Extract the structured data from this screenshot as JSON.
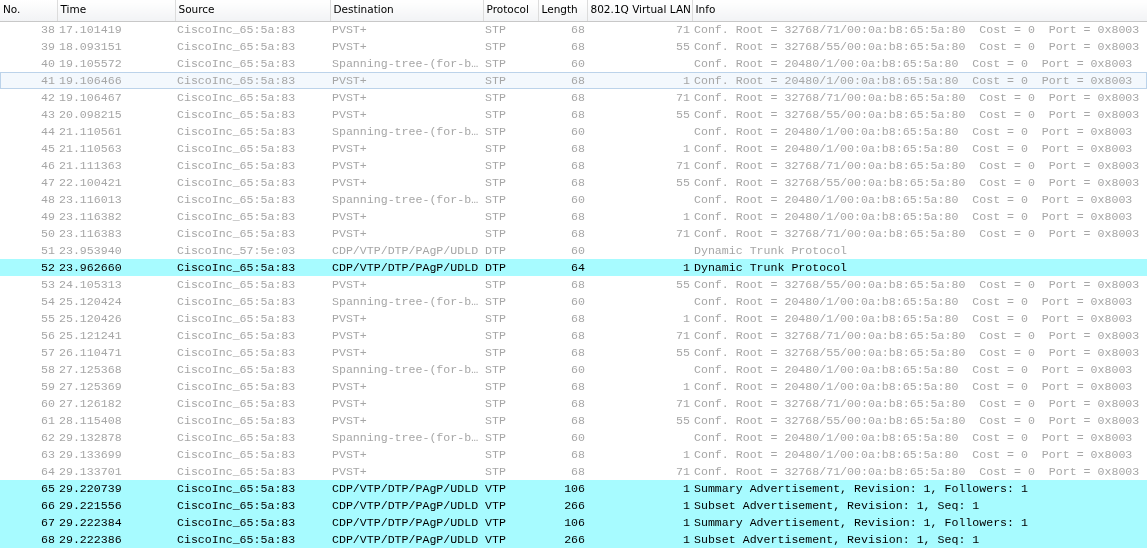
{
  "packet_list": {
    "columns": [
      "No.",
      "Time",
      "Source",
      "Destination",
      "Protocol",
      "Length",
      "802.1Q Virtual LAN",
      "Info"
    ],
    "rows": [
      {
        "no": "38",
        "time": "17.101419",
        "source": "CiscoInc_65:5a:83",
        "destination": "PVST+",
        "protocol": "STP",
        "length": "68",
        "vlan": "71",
        "info": "Conf. Root = 32768/71/00:0a:b8:65:5a:80  Cost = 0  Port = 0x8003",
        "highlighted": false,
        "selected": false
      },
      {
        "no": "39",
        "time": "18.093151",
        "source": "CiscoInc_65:5a:83",
        "destination": "PVST+",
        "protocol": "STP",
        "length": "68",
        "vlan": "55",
        "info": "Conf. Root = 32768/55/00:0a:b8:65:5a:80  Cost = 0  Port = 0x8003",
        "highlighted": false,
        "selected": false
      },
      {
        "no": "40",
        "time": "19.105572",
        "source": "CiscoInc_65:5a:83",
        "destination": "Spanning-tree-(for-b…",
        "protocol": "STP",
        "length": "60",
        "info": "Conf. Root = 20480/1/00:0a:b8:65:5a:80  Cost = 0  Port = 0x8003",
        "highlighted": false,
        "selected": false
      },
      {
        "no": "41",
        "time": "19.106466",
        "source": "CiscoInc_65:5a:83",
        "destination": "PVST+",
        "protocol": "STP",
        "length": "68",
        "vlan": "1",
        "info": "Conf. Root = 20480/1/00:0a:b8:65:5a:80  Cost = 0  Port = 0x8003",
        "highlighted": false,
        "selected": true
      },
      {
        "no": "42",
        "time": "19.106467",
        "source": "CiscoInc_65:5a:83",
        "destination": "PVST+",
        "protocol": "STP",
        "length": "68",
        "vlan": "71",
        "info": "Conf. Root = 32768/71/00:0a:b8:65:5a:80  Cost = 0  Port = 0x8003",
        "highlighted": false,
        "selected": false
      },
      {
        "no": "43",
        "time": "20.098215",
        "source": "CiscoInc_65:5a:83",
        "destination": "PVST+",
        "protocol": "STP",
        "length": "68",
        "vlan": "55",
        "info": "Conf. Root = 32768/55/00:0a:b8:65:5a:80  Cost = 0  Port = 0x8003",
        "highlighted": false,
        "selected": false
      },
      {
        "no": "44",
        "time": "21.110561",
        "source": "CiscoInc_65:5a:83",
        "destination": "Spanning-tree-(for-b…",
        "protocol": "STP",
        "length": "60",
        "info": "Conf. Root = 20480/1/00:0a:b8:65:5a:80  Cost = 0  Port = 0x8003",
        "highlighted": false,
        "selected": false
      },
      {
        "no": "45",
        "time": "21.110563",
        "source": "CiscoInc_65:5a:83",
        "destination": "PVST+",
        "protocol": "STP",
        "length": "68",
        "vlan": "1",
        "info": "Conf. Root = 20480/1/00:0a:b8:65:5a:80  Cost = 0  Port = 0x8003",
        "highlighted": false,
        "selected": false
      },
      {
        "no": "46",
        "time": "21.111363",
        "source": "CiscoInc_65:5a:83",
        "destination": "PVST+",
        "protocol": "STP",
        "length": "68",
        "vlan": "71",
        "info": "Conf. Root = 32768/71/00:0a:b8:65:5a:80  Cost = 0  Port = 0x8003",
        "highlighted": false,
        "selected": false
      },
      {
        "no": "47",
        "time": "22.100421",
        "source": "CiscoInc_65:5a:83",
        "destination": "PVST+",
        "protocol": "STP",
        "length": "68",
        "vlan": "55",
        "info": "Conf. Root = 32768/55/00:0a:b8:65:5a:80  Cost = 0  Port = 0x8003",
        "highlighted": false,
        "selected": false
      },
      {
        "no": "48",
        "time": "23.116013",
        "source": "CiscoInc_65:5a:83",
        "destination": "Spanning-tree-(for-b…",
        "protocol": "STP",
        "length": "60",
        "info": "Conf. Root = 20480/1/00:0a:b8:65:5a:80  Cost = 0  Port = 0x8003",
        "highlighted": false,
        "selected": false
      },
      {
        "no": "49",
        "time": "23.116382",
        "source": "CiscoInc_65:5a:83",
        "destination": "PVST+",
        "protocol": "STP",
        "length": "68",
        "vlan": "1",
        "info": "Conf. Root = 20480/1/00:0a:b8:65:5a:80  Cost = 0  Port = 0x8003",
        "highlighted": false,
        "selected": false
      },
      {
        "no": "50",
        "time": "23.116383",
        "source": "CiscoInc_65:5a:83",
        "destination": "PVST+",
        "protocol": "STP",
        "length": "68",
        "vlan": "71",
        "info": "Conf. Root = 32768/71/00:0a:b8:65:5a:80  Cost = 0  Port = 0x8003",
        "highlighted": false,
        "selected": false
      },
      {
        "no": "51",
        "time": "23.953940",
        "source": "CiscoInc_57:5e:03",
        "destination": "CDP/VTP/DTP/PAgP/UDLD",
        "protocol": "DTP",
        "length": "60",
        "info": "Dynamic Trunk Protocol",
        "highlighted": false,
        "selected": false
      },
      {
        "no": "52",
        "time": "23.962660",
        "source": "CiscoInc_65:5a:83",
        "destination": "CDP/VTP/DTP/PAgP/UDLD",
        "protocol": "DTP",
        "length": "64",
        "vlan": "1",
        "info": "Dynamic Trunk Protocol",
        "highlighted": true,
        "selected": false
      },
      {
        "no": "53",
        "time": "24.105313",
        "source": "CiscoInc_65:5a:83",
        "destination": "PVST+",
        "protocol": "STP",
        "length": "68",
        "vlan": "55",
        "info": "Conf. Root = 32768/55/00:0a:b8:65:5a:80  Cost = 0  Port = 0x8003",
        "highlighted": false,
        "selected": false
      },
      {
        "no": "54",
        "time": "25.120424",
        "source": "CiscoInc_65:5a:83",
        "destination": "Spanning-tree-(for-b…",
        "protocol": "STP",
        "length": "60",
        "info": "Conf. Root = 20480/1/00:0a:b8:65:5a:80  Cost = 0  Port = 0x8003",
        "highlighted": false,
        "selected": false
      },
      {
        "no": "55",
        "time": "25.120426",
        "source": "CiscoInc_65:5a:83",
        "destination": "PVST+",
        "protocol": "STP",
        "length": "68",
        "vlan": "1",
        "info": "Conf. Root = 20480/1/00:0a:b8:65:5a:80  Cost = 0  Port = 0x8003",
        "highlighted": false,
        "selected": false
      },
      {
        "no": "56",
        "time": "25.121241",
        "source": "CiscoInc_65:5a:83",
        "destination": "PVST+",
        "protocol": "STP",
        "length": "68",
        "vlan": "71",
        "info": "Conf. Root = 32768/71/00:0a:b8:65:5a:80  Cost = 0  Port = 0x8003",
        "highlighted": false,
        "selected": false
      },
      {
        "no": "57",
        "time": "26.110471",
        "source": "CiscoInc_65:5a:83",
        "destination": "PVST+",
        "protocol": "STP",
        "length": "68",
        "vlan": "55",
        "info": "Conf. Root = 32768/55/00:0a:b8:65:5a:80  Cost = 0  Port = 0x8003",
        "highlighted": false,
        "selected": false
      },
      {
        "no": "58",
        "time": "27.125368",
        "source": "CiscoInc_65:5a:83",
        "destination": "Spanning-tree-(for-b…",
        "protocol": "STP",
        "length": "60",
        "info": "Conf. Root = 20480/1/00:0a:b8:65:5a:80  Cost = 0  Port = 0x8003",
        "highlighted": false,
        "selected": false
      },
      {
        "no": "59",
        "time": "27.125369",
        "source": "CiscoInc_65:5a:83",
        "destination": "PVST+",
        "protocol": "STP",
        "length": "68",
        "vlan": "1",
        "info": "Conf. Root = 20480/1/00:0a:b8:65:5a:80  Cost = 0  Port = 0x8003",
        "highlighted": false,
        "selected": false
      },
      {
        "no": "60",
        "time": "27.126182",
        "source": "CiscoInc_65:5a:83",
        "destination": "PVST+",
        "protocol": "STP",
        "length": "68",
        "vlan": "71",
        "info": "Conf. Root = 32768/71/00:0a:b8:65:5a:80  Cost = 0  Port = 0x8003",
        "highlighted": false,
        "selected": false
      },
      {
        "no": "61",
        "time": "28.115408",
        "source": "CiscoInc_65:5a:83",
        "destination": "PVST+",
        "protocol": "STP",
        "length": "68",
        "vlan": "55",
        "info": "Conf. Root = 32768/55/00:0a:b8:65:5a:80  Cost = 0  Port = 0x8003",
        "highlighted": false,
        "selected": false
      },
      {
        "no": "62",
        "time": "29.132878",
        "source": "CiscoInc_65:5a:83",
        "destination": "Spanning-tree-(for-b…",
        "protocol": "STP",
        "length": "60",
        "info": "Conf. Root = 20480/1/00:0a:b8:65:5a:80  Cost = 0  Port = 0x8003",
        "highlighted": false,
        "selected": false
      },
      {
        "no": "63",
        "time": "29.133699",
        "source": "CiscoInc_65:5a:83",
        "destination": "PVST+",
        "protocol": "STP",
        "length": "68",
        "vlan": "1",
        "info": "Conf. Root = 20480/1/00:0a:b8:65:5a:80  Cost = 0  Port = 0x8003",
        "highlighted": false,
        "selected": false
      },
      {
        "no": "64",
        "time": "29.133701",
        "source": "CiscoInc_65:5a:83",
        "destination": "PVST+",
        "protocol": "STP",
        "length": "68",
        "vlan": "71",
        "info": "Conf. Root = 32768/71/00:0a:b8:65:5a:80  Cost = 0  Port = 0x8003",
        "highlighted": false,
        "selected": false
      },
      {
        "no": "65",
        "time": "29.220739",
        "source": "CiscoInc_65:5a:83",
        "destination": "CDP/VTP/DTP/PAgP/UDLD",
        "protocol": "VTP",
        "length": "106",
        "vlan": "1",
        "info": "Summary Advertisement, Revision: 1, Followers: 1",
        "highlighted": true,
        "selected": false
      },
      {
        "no": "66",
        "time": "29.221556",
        "source": "CiscoInc_65:5a:83",
        "destination": "CDP/VTP/DTP/PAgP/UDLD",
        "protocol": "VTP",
        "length": "266",
        "vlan": "1",
        "info": "Subset Advertisement, Revision: 1, Seq: 1",
        "highlighted": true,
        "selected": false
      },
      {
        "no": "67",
        "time": "29.222384",
        "source": "CiscoInc_65:5a:83",
        "destination": "CDP/VTP/DTP/PAgP/UDLD",
        "protocol": "VTP",
        "length": "106",
        "vlan": "1",
        "info": "Summary Advertisement, Revision: 1, Followers: 1",
        "highlighted": true,
        "selected": false
      },
      {
        "no": "68",
        "time": "29.222386",
        "source": "CiscoInc_65:5a:83",
        "destination": "CDP/VTP/DTP/PAgP/UDLD",
        "protocol": "VTP",
        "length": "266",
        "vlan": "1",
        "info": "Subset Advertisement, Revision: 1, Seq: 1",
        "highlighted": true,
        "selected": false
      }
    ]
  }
}
